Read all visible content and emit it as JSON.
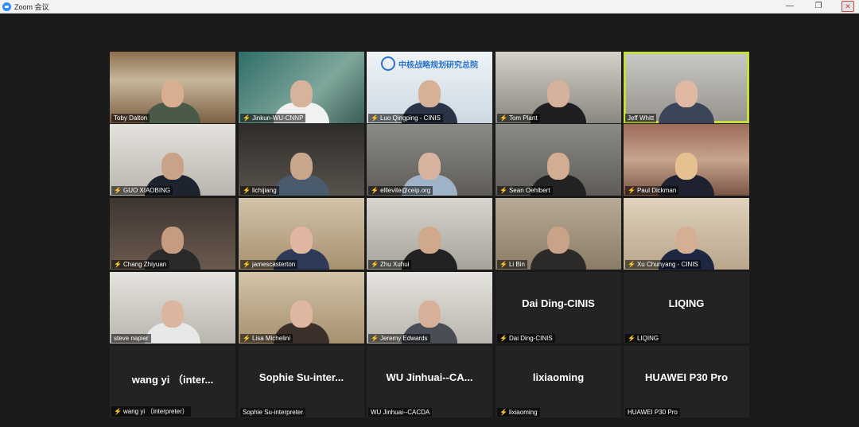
{
  "window": {
    "title": "Zoom 会议"
  },
  "tiles": [
    {
      "name": "Toby Dalton",
      "muted": false,
      "bg": "bg-shelf",
      "skin": "#d9ad90",
      "shirt": "#4a5a48"
    },
    {
      "name": "Jinkun-WU-CNNP",
      "muted": true,
      "bg": "bg-teal",
      "skin": "#d6b39a",
      "shirt": "#f1f1f1"
    },
    {
      "name": "Luo Qingping - CINIS",
      "muted": true,
      "bg": "bg-white",
      "skin": "#d7b195",
      "shirt": "#2b3446"
    },
    {
      "name": "Tom Plant",
      "muted": true,
      "bg": "bg-room",
      "skin": "#d5b29c",
      "shirt": "#1f1f22"
    },
    {
      "name": "Jeff Whitt",
      "muted": false,
      "bg": "bg-grey",
      "skin": "#e0b8a4",
      "shirt": "#3a4658",
      "active": true
    },
    {
      "name": "GUO XIAOBING",
      "muted": true,
      "bg": "bg-wall",
      "skin": "#c9a387",
      "shirt": "#1d2430"
    },
    {
      "name": "lichijiang",
      "muted": true,
      "bg": "bg-dark",
      "skin": "#c9a68b",
      "shirt": "#4b5b6e"
    },
    {
      "name": "elllevite@ceip.org",
      "muted": true,
      "bg": "bg-office",
      "skin": "#d8b4a0",
      "shirt": "#9fb3c8"
    },
    {
      "name": "Sean Oehlbert",
      "muted": true,
      "bg": "bg-office",
      "skin": "#d2ad93",
      "shirt": "#222"
    },
    {
      "name": "Paul Dickman",
      "muted": true,
      "bg": "bg-books",
      "skin": "#e6c090",
      "shirt": "#1e2230"
    },
    {
      "name": "Chang Zhiyuan",
      "muted": true,
      "bg": "bg-brown",
      "skin": "#c59c7d",
      "shirt": "#2a2a2a"
    },
    {
      "name": "jamescasterton",
      "muted": true,
      "bg": "bg-warm",
      "skin": "#e0b6a2",
      "shirt": "#2f3a58"
    },
    {
      "name": "Zhu Xuhui",
      "muted": true,
      "bg": "bg-kitchen",
      "skin": "#d0a88c",
      "shirt": "#222"
    },
    {
      "name": "Li Bin",
      "muted": true,
      "bg": "bg-blur",
      "skin": "#c8a387",
      "shirt": "#2c2a29"
    },
    {
      "name": "Xu Chunyang - CINIS",
      "muted": true,
      "bg": "bg-beige",
      "skin": "#d4af94",
      "shirt": "#1e2742"
    },
    {
      "name": "steve napier",
      "muted": false,
      "bg": "bg-wall",
      "skin": "#dcb59f",
      "shirt": "#e8e8e8"
    },
    {
      "name": "Lisa Michelini",
      "muted": true,
      "bg": "bg-warm",
      "skin": "#dfb7a0",
      "shirt": "#3b2f29"
    },
    {
      "name": "Jeremy Edwards",
      "muted": true,
      "bg": "bg-wall",
      "skin": "#d7b09a",
      "shirt": "#4a4d55"
    },
    {
      "name": "Dai Ding-CINIS",
      "muted": true,
      "display": "Dai Ding-CINIS"
    },
    {
      "name": "LIQING",
      "muted": true,
      "display": "LIQING"
    },
    {
      "name": "wang yi （interpreter）",
      "muted": true,
      "display": "wang yi （inter..."
    },
    {
      "name": "Sophie Su-interpreter",
      "muted": false,
      "display": "Sophie Su-inter..."
    },
    {
      "name": "WU Jinhuai--CACDA",
      "muted": false,
      "display": "WU Jinhuai--CA..."
    },
    {
      "name": "lixiaoming",
      "muted": true,
      "display": "lixiaoming"
    },
    {
      "name": "HUAWEI P30 Pro",
      "muted": false,
      "display": "HUAWEI P30 Pro"
    }
  ],
  "cinis_logo": "中核战略规划研究总院"
}
